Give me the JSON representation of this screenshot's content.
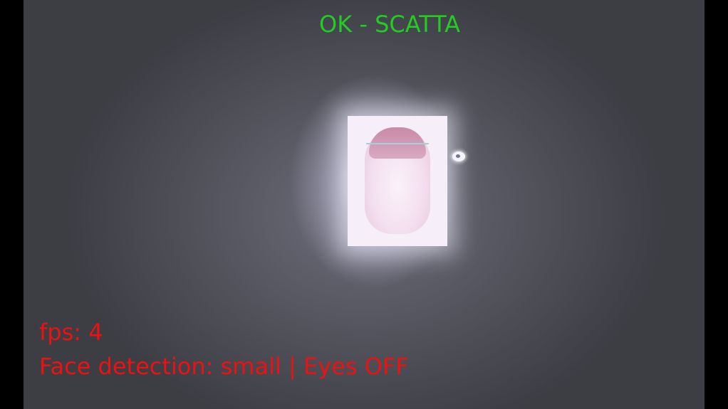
{
  "overlay": {
    "status": "OK - SCATTA",
    "fps": "fps: 4",
    "detection": "Face detection: small | Eyes OFF"
  },
  "colors": {
    "status": "#22cc22",
    "info": "#ee1111",
    "letterbox": "#000000"
  },
  "icons": {
    "cursor": "pointer-blob-icon"
  }
}
